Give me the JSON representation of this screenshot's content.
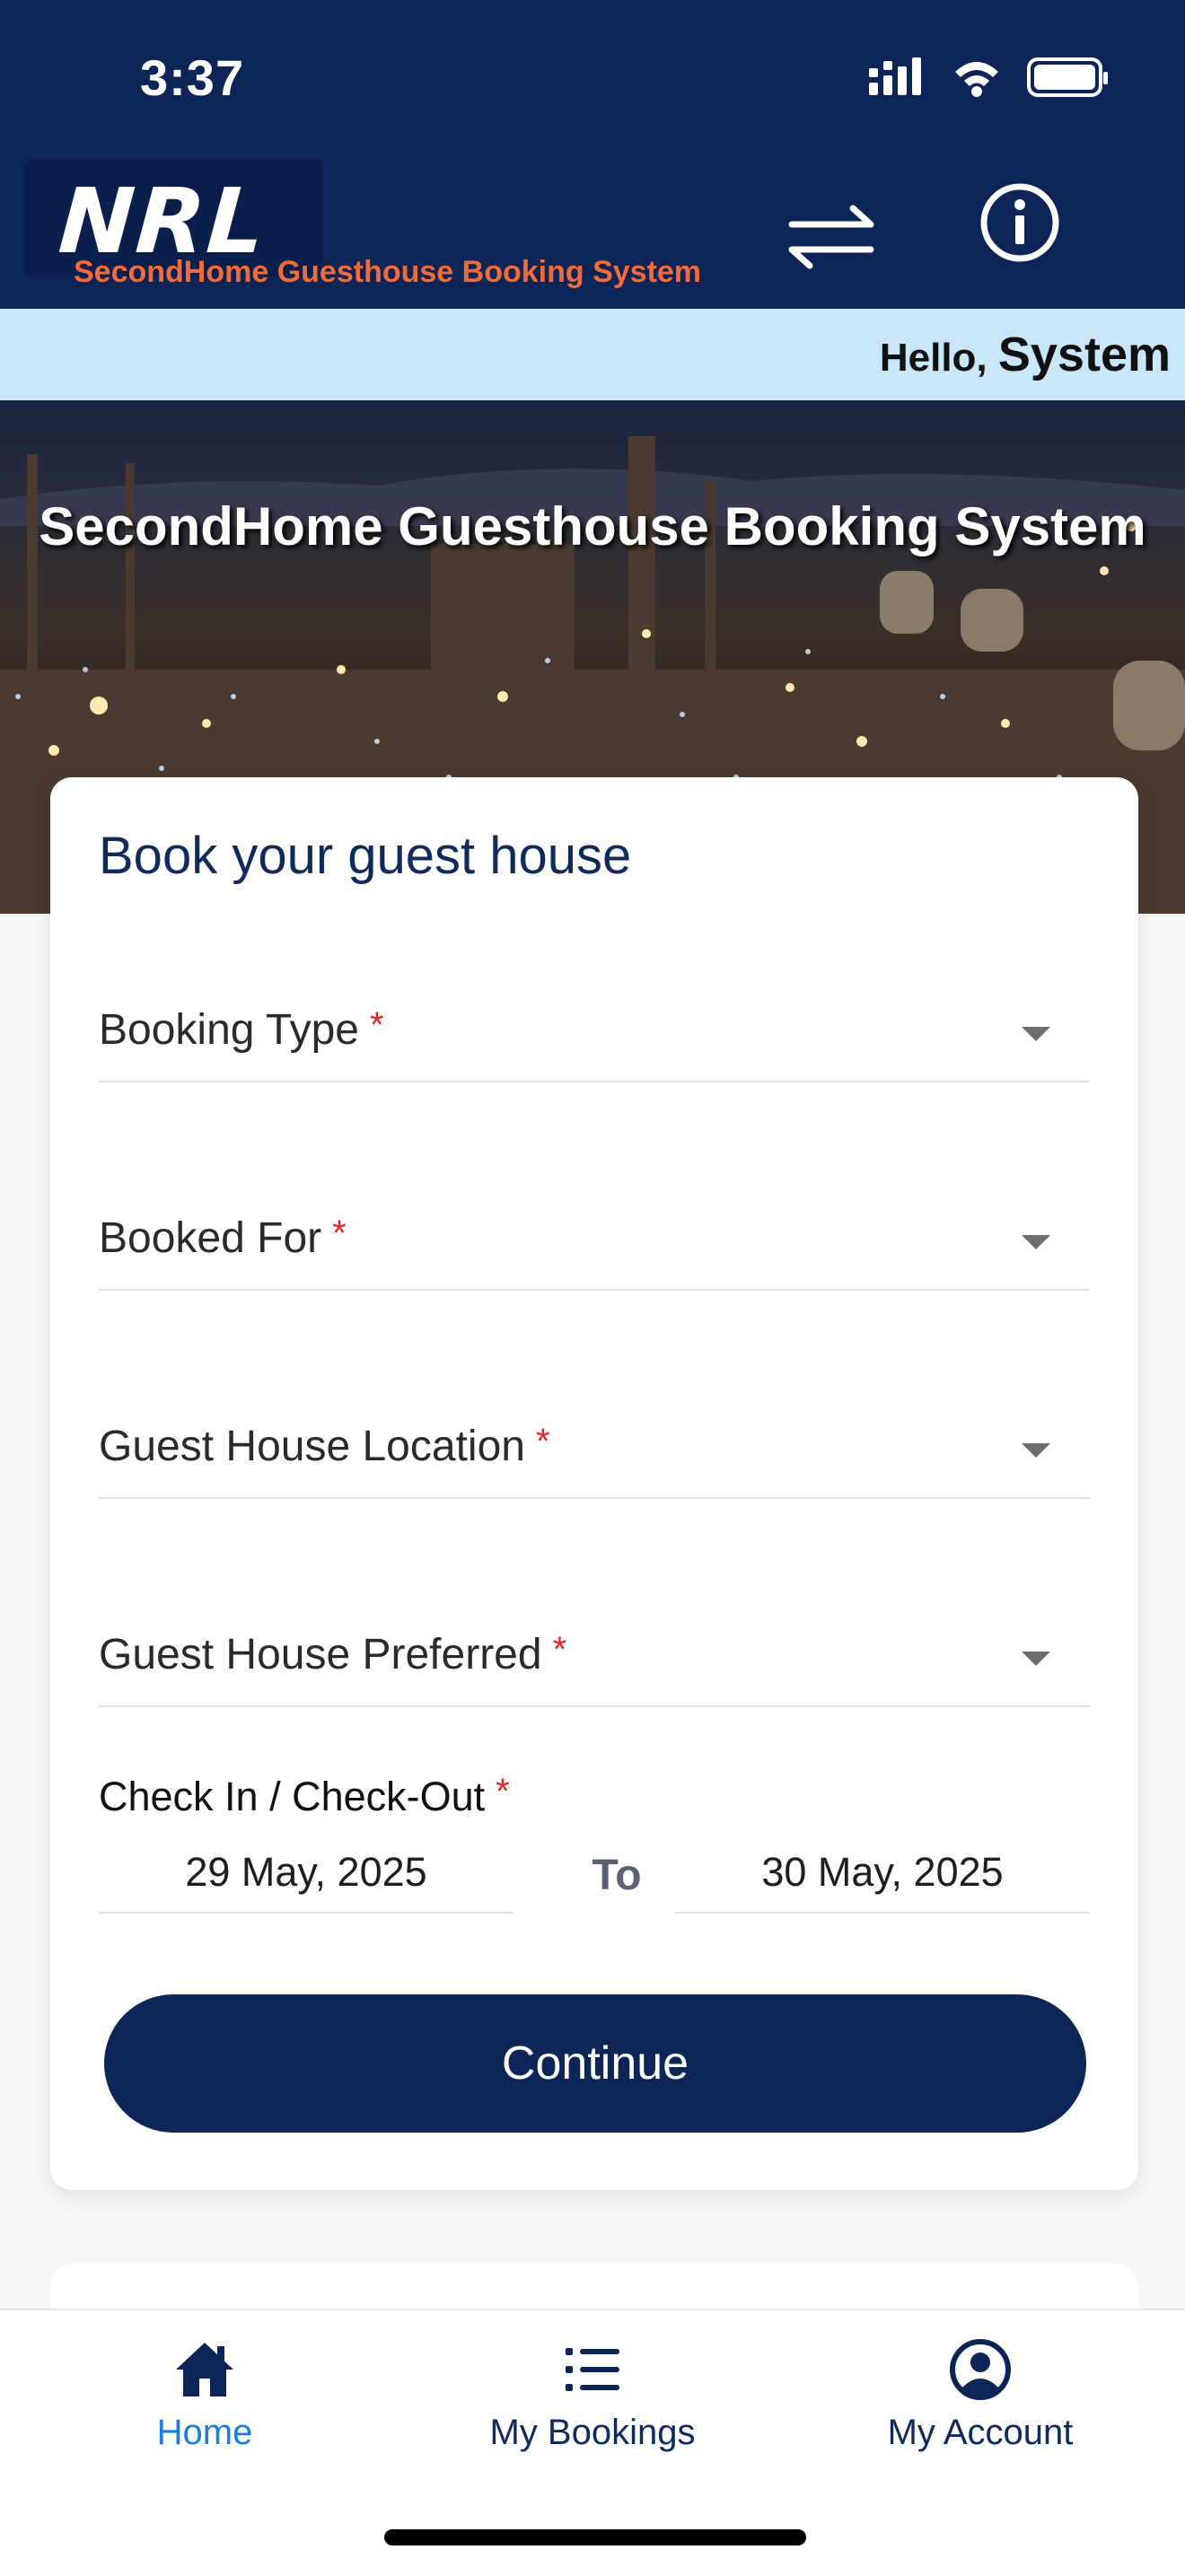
{
  "status_bar": {
    "time": "3:37"
  },
  "header": {
    "logo_text": "NRL",
    "logo_subtitle": "SecondHome Guesthouse Booking System",
    "swap_icon": "swap-arrows-icon",
    "info_icon": "info-icon"
  },
  "greeting": {
    "hello": "Hello,",
    "user_name": "System"
  },
  "hero": {
    "title": "SecondHome Guesthouse Booking System"
  },
  "booking_form": {
    "title": "Book your guest house",
    "required_marker": "*",
    "fields": [
      {
        "label": "Booking Type"
      },
      {
        "label": "Booked For"
      },
      {
        "label": "Guest House Location"
      },
      {
        "label": "Guest House Preferred"
      }
    ],
    "dates_label": "Check In / Check-Out",
    "check_in": "29 May, 2025",
    "to_label": "To",
    "check_out": "30 May, 2025",
    "continue_label": "Continue"
  },
  "bottom_nav": {
    "items": [
      {
        "label": "Home",
        "icon": "home-icon",
        "active": true
      },
      {
        "label": "My Bookings",
        "icon": "list-icon",
        "active": false
      },
      {
        "label": "My Account",
        "icon": "account-icon",
        "active": false
      }
    ]
  },
  "colors": {
    "primary_navy": "#0d2456",
    "accent_orange": "#f26b3a",
    "greeting_bg": "#c9e6fb",
    "active_nav": "#1a7de0",
    "required_red": "#e0262b"
  }
}
